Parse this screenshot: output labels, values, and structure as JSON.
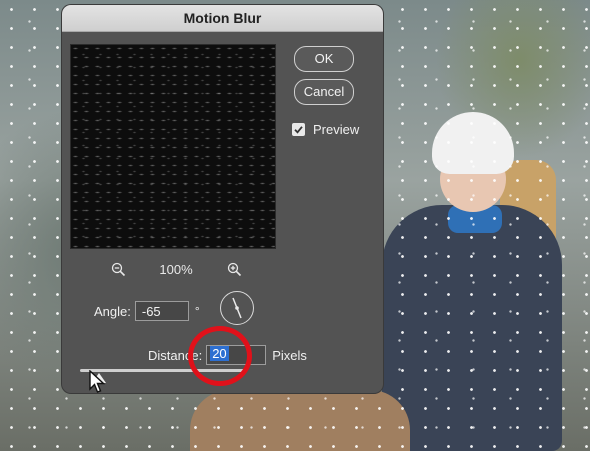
{
  "dialog": {
    "title": "Motion Blur",
    "ok_label": "OK",
    "cancel_label": "Cancel",
    "preview_label": "Preview",
    "preview_checked": true,
    "zoom_level": "100%",
    "angle_label": "Angle:",
    "angle_value": "-65",
    "angle_unit": "°",
    "distance_label": "Distance:",
    "distance_value": "20",
    "distance_unit": "Pixels"
  },
  "icons": {
    "zoom_out": "zoom-out-icon",
    "zoom_in": "zoom-in-icon",
    "checkbox": "check-icon",
    "angle_dial": "angle-dial-icon",
    "cursor": "mouse-pointer-icon"
  },
  "colors": {
    "dialog_bg": "#535353",
    "highlight": "#2d6fd1",
    "annotation": "#e0111a"
  }
}
